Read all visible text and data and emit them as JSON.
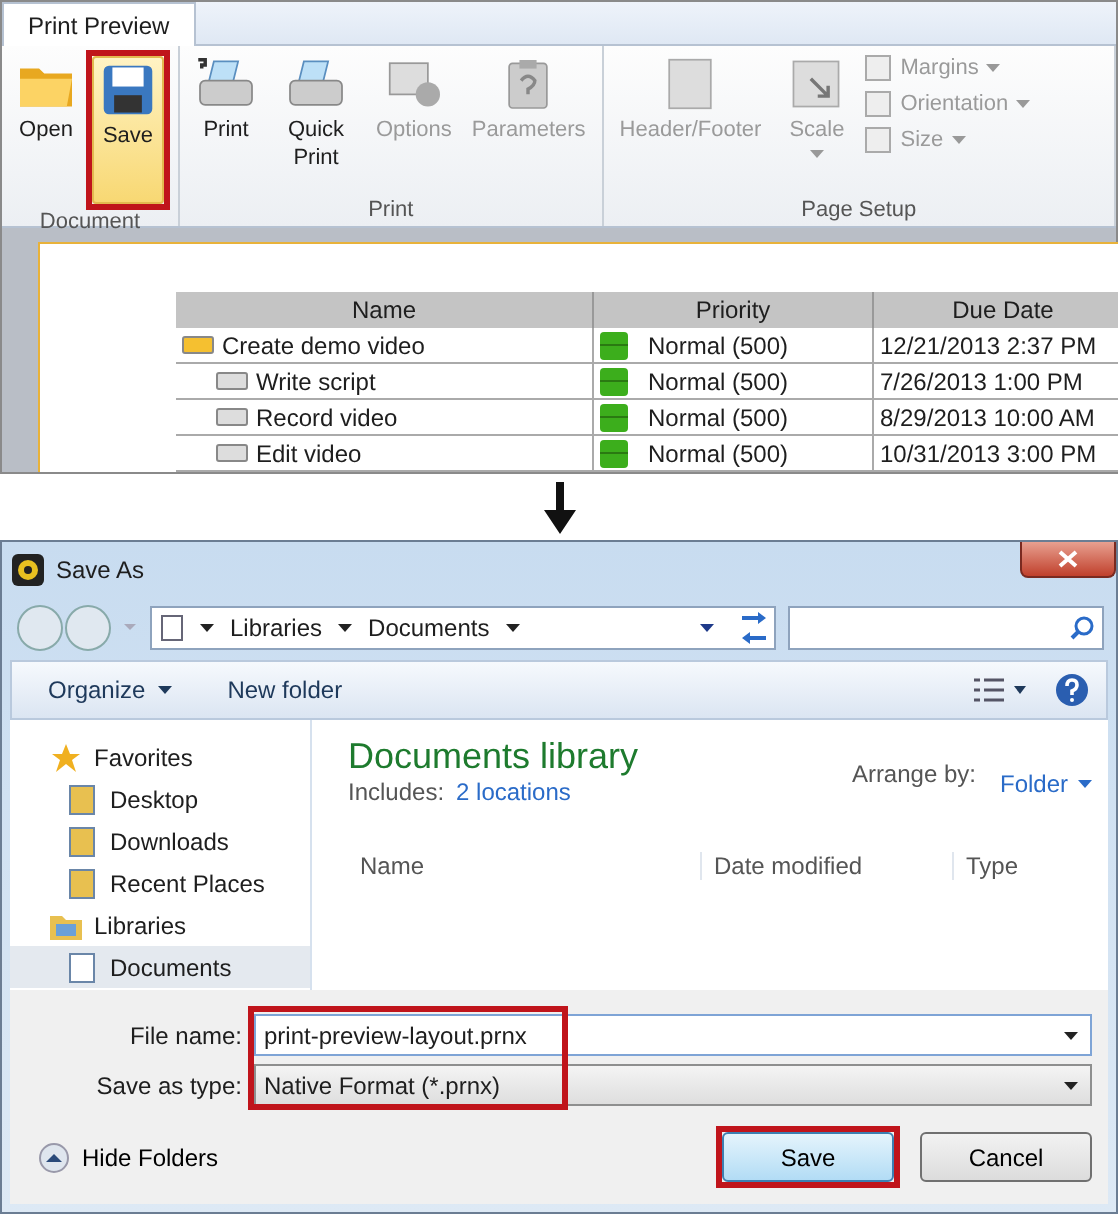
{
  "ribbon": {
    "tabs": [
      {
        "label": "Print Preview",
        "selected": true
      }
    ],
    "groups": [
      {
        "label": "Document",
        "items": [
          {
            "label": "Open",
            "kind": "large",
            "disabled": false,
            "selected": false,
            "callout": false,
            "dropdown": false
          },
          {
            "label": "Save",
            "kind": "large",
            "disabled": false,
            "selected": true,
            "callout": true,
            "dropdown": false
          }
        ]
      },
      {
        "label": "Print",
        "items": [
          {
            "label": "Print",
            "kind": "large",
            "disabled": false,
            "selected": false,
            "callout": false,
            "dropdown": false
          },
          {
            "label": "Quick Print",
            "kind": "large",
            "disabled": false,
            "selected": false,
            "callout": false,
            "dropdown": false
          },
          {
            "label": "Options",
            "kind": "large",
            "disabled": true,
            "selected": false,
            "callout": false,
            "dropdown": false
          },
          {
            "label": "Parameters",
            "kind": "large",
            "disabled": true,
            "selected": false,
            "callout": false,
            "dropdown": false
          }
        ]
      },
      {
        "label": "Page Setup",
        "items": [
          {
            "label": "Header/Footer",
            "kind": "large",
            "disabled": true,
            "selected": false,
            "callout": false,
            "dropdown": false
          },
          {
            "label": "Scale",
            "kind": "large",
            "disabled": true,
            "selected": false,
            "callout": false,
            "dropdown": true
          },
          {
            "label": "Margins",
            "kind": "small",
            "disabled": true,
            "selected": false,
            "callout": false,
            "dropdown": true
          },
          {
            "label": "Orientation",
            "kind": "small",
            "disabled": true,
            "selected": false,
            "callout": false,
            "dropdown": true
          },
          {
            "label": "Size",
            "kind": "small",
            "disabled": true,
            "selected": false,
            "callout": false,
            "dropdown": true
          }
        ]
      }
    ]
  },
  "preview": {
    "columns": [
      "Name",
      "Priority",
      "Due Date"
    ],
    "tasks": [
      {
        "name": "Create demo video",
        "priority": "Normal (500)",
        "due": "12/21/2013 2:37 PM",
        "children": [
          {
            "name": "Write script",
            "priority": "Normal (500)",
            "due": "7/26/2013 1:00 PM"
          },
          {
            "name": "Record video",
            "priority": "Normal (500)",
            "due": "8/29/2013 10:00 AM"
          },
          {
            "name": "Edit video",
            "priority": "Normal (500)",
            "due": "10/31/2013 3:00 PM"
          }
        ]
      }
    ]
  },
  "dialog": {
    "title": "Save As",
    "breadcrumb": [
      "Libraries",
      "Documents"
    ],
    "toolbar": [
      "Organize",
      "New folder"
    ],
    "nav": [
      {
        "label": "Favorites",
        "selected": false,
        "children": [
          {
            "label": "Desktop",
            "selected": false
          },
          {
            "label": "Downloads",
            "selected": false
          },
          {
            "label": "Recent Places",
            "selected": false
          }
        ]
      },
      {
        "label": "Libraries",
        "selected": false,
        "children": [
          {
            "label": "Documents",
            "selected": true
          }
        ]
      }
    ],
    "library": {
      "title": "Documents library",
      "includes_label": "Includes:",
      "includes_link": "2 locations",
      "arrange_label": "Arrange by:",
      "arrange_value": "Folder"
    },
    "columns": [
      "Name",
      "Date modified",
      "Type"
    ],
    "form": {
      "callout": true,
      "fields": [
        {
          "label": "File name:",
          "value": "print-preview-layout.prnx",
          "kind": "input"
        },
        {
          "label": "Save as type:",
          "value": "Native Format (*.prnx)",
          "kind": "select"
        }
      ]
    },
    "hide_folders": "Hide Folders",
    "buttons": [
      {
        "label": "Save",
        "callout": true
      },
      {
        "label": "Cancel",
        "callout": false
      }
    ]
  }
}
